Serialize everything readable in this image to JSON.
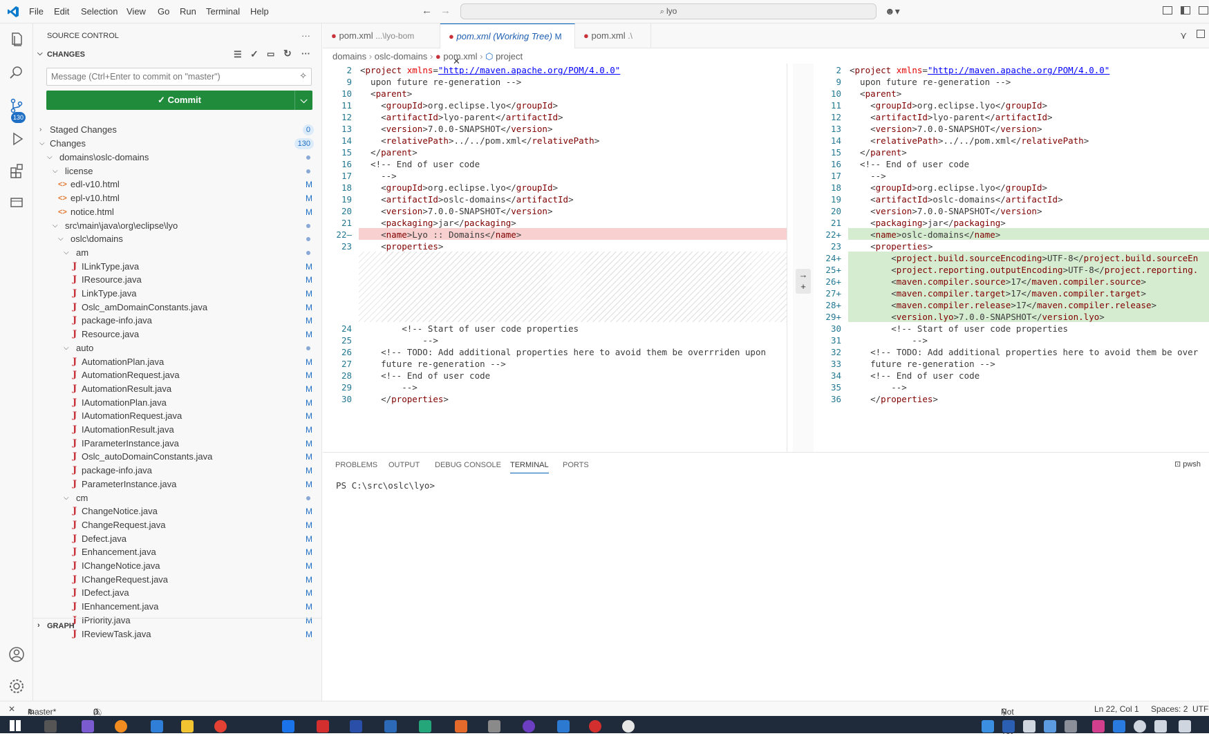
{
  "titlebar": {
    "menus": [
      "File",
      "Edit",
      "Selection",
      "View",
      "Go",
      "Run",
      "Terminal",
      "Help"
    ],
    "search": "lyo"
  },
  "activity": {
    "scm_badge": "130"
  },
  "sidebar": {
    "title": "SOURCE CONTROL",
    "changes_header": "CHANGES",
    "message_placeholder": "Message (Ctrl+Enter to commit on \"master\")",
    "commit_label": "Commit",
    "staged_label": "Staged Changes",
    "staged_count": "0",
    "changes_label": "Changes",
    "changes_count": "130",
    "graph_label": "GRAPH",
    "tree": [
      {
        "label": "domains\\oslc-domains",
        "type": "folder",
        "depth": 1,
        "status": "dot"
      },
      {
        "label": "license",
        "type": "folder",
        "depth": 2,
        "status": "dot"
      },
      {
        "label": "edl-v10.html",
        "type": "html",
        "depth": 3,
        "status": "M"
      },
      {
        "label": "epl-v10.html",
        "type": "html",
        "depth": 3,
        "status": "M"
      },
      {
        "label": "notice.html",
        "type": "html",
        "depth": 3,
        "status": "M"
      },
      {
        "label": "src\\main\\java\\org\\eclipse\\lyo",
        "type": "folder",
        "depth": 2,
        "status": "dot"
      },
      {
        "label": "oslc\\domains",
        "type": "folder",
        "depth": 3,
        "status": "dot"
      },
      {
        "label": "am",
        "type": "folder",
        "depth": 4,
        "status": "dot"
      },
      {
        "label": "ILinkType.java",
        "type": "java",
        "depth": 5,
        "status": "M"
      },
      {
        "label": "IResource.java",
        "type": "java",
        "depth": 5,
        "status": "M"
      },
      {
        "label": "LinkType.java",
        "type": "java",
        "depth": 5,
        "status": "M"
      },
      {
        "label": "Oslc_amDomainConstants.java",
        "type": "java",
        "depth": 5,
        "status": "M"
      },
      {
        "label": "package-info.java",
        "type": "java",
        "depth": 5,
        "status": "M"
      },
      {
        "label": "Resource.java",
        "type": "java",
        "depth": 5,
        "status": "M"
      },
      {
        "label": "auto",
        "type": "folder",
        "depth": 4,
        "status": "dot"
      },
      {
        "label": "AutomationPlan.java",
        "type": "java",
        "depth": 5,
        "status": "M"
      },
      {
        "label": "AutomationRequest.java",
        "type": "java",
        "depth": 5,
        "status": "M"
      },
      {
        "label": "AutomationResult.java",
        "type": "java",
        "depth": 5,
        "status": "M"
      },
      {
        "label": "IAutomationPlan.java",
        "type": "java",
        "depth": 5,
        "status": "M"
      },
      {
        "label": "IAutomationRequest.java",
        "type": "java",
        "depth": 5,
        "status": "M"
      },
      {
        "label": "IAutomationResult.java",
        "type": "java",
        "depth": 5,
        "status": "M"
      },
      {
        "label": "IParameterInstance.java",
        "type": "java",
        "depth": 5,
        "status": "M"
      },
      {
        "label": "Oslc_autoDomainConstants.java",
        "type": "java",
        "depth": 5,
        "status": "M"
      },
      {
        "label": "package-info.java",
        "type": "java",
        "depth": 5,
        "status": "M"
      },
      {
        "label": "ParameterInstance.java",
        "type": "java",
        "depth": 5,
        "status": "M"
      },
      {
        "label": "cm",
        "type": "folder",
        "depth": 4,
        "status": "dot"
      },
      {
        "label": "ChangeNotice.java",
        "type": "java",
        "depth": 5,
        "status": "M"
      },
      {
        "label": "ChangeRequest.java",
        "type": "java",
        "depth": 5,
        "status": "M"
      },
      {
        "label": "Defect.java",
        "type": "java",
        "depth": 5,
        "status": "M"
      },
      {
        "label": "Enhancement.java",
        "type": "java",
        "depth": 5,
        "status": "M"
      },
      {
        "label": "IChangeNotice.java",
        "type": "java",
        "depth": 5,
        "status": "M"
      },
      {
        "label": "IChangeRequest.java",
        "type": "java",
        "depth": 5,
        "status": "M"
      },
      {
        "label": "IDefect.java",
        "type": "java",
        "depth": 5,
        "status": "M"
      },
      {
        "label": "IEnhancement.java",
        "type": "java",
        "depth": 5,
        "status": "M"
      },
      {
        "label": "IPriority.java",
        "type": "java",
        "depth": 5,
        "status": "M"
      },
      {
        "label": "IReviewTask.java",
        "type": "java",
        "depth": 5,
        "status": "M"
      }
    ]
  },
  "editor": {
    "tabs": [
      {
        "name": "pom.xml",
        "desc": "...\\lyo-bom",
        "active": false
      },
      {
        "name": "pom.xml (Working Tree)",
        "desc": "M",
        "active": true
      },
      {
        "name": "pom.xml",
        "desc": ".\\",
        "active": false
      }
    ],
    "breadcrumbs": [
      "domains",
      "oslc-domains",
      "pom.xml",
      "project"
    ],
    "left_lines": [
      {
        "n": "2",
        "t": "<project xmlns=\"http://maven.apache.org/POM/4.0.0\""
      },
      {
        "n": "9",
        "t": "  upon future re-generation -->"
      },
      {
        "n": "10",
        "t": "  <parent>"
      },
      {
        "n": "11",
        "t": "    <groupId>org.eclipse.lyo</groupId>"
      },
      {
        "n": "12",
        "t": "    <artifactId>lyo-parent</artifactId>"
      },
      {
        "n": "13",
        "t": "    <version>7.0.0-SNAPSHOT</version>"
      },
      {
        "n": "14",
        "t": "    <relativePath>../../pom.xml</relativePath>"
      },
      {
        "n": "15",
        "t": "  </parent>"
      },
      {
        "n": "16",
        "t": "  <!-- End of user code"
      },
      {
        "n": "17",
        "t": "    -->"
      },
      {
        "n": "18",
        "t": "    <groupId>org.eclipse.lyo</groupId>"
      },
      {
        "n": "19",
        "t": "    <artifactId>oslc-domains</artifactId>"
      },
      {
        "n": "20",
        "t": "    <version>7.0.0-SNAPSHOT</version>"
      },
      {
        "n": "21",
        "t": "    <packaging>jar</packaging>"
      },
      {
        "n": "22—",
        "t": "    <name>Lyo :: Domains</name>"
      },
      {
        "n": "23",
        "t": "    <properties>"
      },
      {
        "n": "",
        "t": ""
      },
      {
        "n": "",
        "t": ""
      },
      {
        "n": "",
        "t": ""
      },
      {
        "n": "",
        "t": ""
      },
      {
        "n": "",
        "t": ""
      },
      {
        "n": "",
        "t": ""
      },
      {
        "n": "24",
        "t": "        <!-- Start of user code properties"
      },
      {
        "n": "25",
        "t": "            -->"
      },
      {
        "n": "26",
        "t": "    <!-- TODO: Add additional properties here to avoid them be overrriden upon"
      },
      {
        "n": "27",
        "t": "    future re-generation -->"
      },
      {
        "n": "28",
        "t": "    <!-- End of user code"
      },
      {
        "n": "29",
        "t": "        -->"
      },
      {
        "n": "30",
        "t": "    </properties>"
      }
    ],
    "right_lines": [
      {
        "n": "2",
        "t": "<project xmlns=\"http://maven.apache.org/POM/4.0.0\""
      },
      {
        "n": "9",
        "t": "  upon future re-generation -->"
      },
      {
        "n": "10",
        "t": "  <parent>"
      },
      {
        "n": "11",
        "t": "    <groupId>org.eclipse.lyo</groupId>"
      },
      {
        "n": "12",
        "t": "    <artifactId>lyo-parent</artifactId>"
      },
      {
        "n": "13",
        "t": "    <version>7.0.0-SNAPSHOT</version>"
      },
      {
        "n": "14",
        "t": "    <relativePath>../../pom.xml</relativePath>"
      },
      {
        "n": "15",
        "t": "  </parent>"
      },
      {
        "n": "16",
        "t": "  <!-- End of user code"
      },
      {
        "n": "17",
        "t": "    -->"
      },
      {
        "n": "18",
        "t": "    <groupId>org.eclipse.lyo</groupId>"
      },
      {
        "n": "19",
        "t": "    <artifactId>oslc-domains</artifactId>"
      },
      {
        "n": "20",
        "t": "    <version>7.0.0-SNAPSHOT</version>"
      },
      {
        "n": "21",
        "t": "    <packaging>jar</packaging>"
      },
      {
        "n": "22+",
        "t": "    <name>oslc-domains</name>"
      },
      {
        "n": "23",
        "t": "    <properties>"
      },
      {
        "n": "24+",
        "t": "        <project.build.sourceEncoding>UTF-8</project.build.sourceEn"
      },
      {
        "n": "25+",
        "t": "        <project.reporting.outputEncoding>UTF-8</project.reporting."
      },
      {
        "n": "26+",
        "t": "        <maven.compiler.source>17</maven.compiler.source>"
      },
      {
        "n": "27+",
        "t": "        <maven.compiler.target>17</maven.compiler.target>"
      },
      {
        "n": "28+",
        "t": "        <maven.compiler.release>17</maven.compiler.release>"
      },
      {
        "n": "29+",
        "t": "        <version.lyo>7.0.0-SNAPSHOT</version.lyo>"
      },
      {
        "n": "30",
        "t": "        <!-- Start of user code properties"
      },
      {
        "n": "31",
        "t": "            -->"
      },
      {
        "n": "32",
        "t": "    <!-- TODO: Add additional properties here to avoid them be over"
      },
      {
        "n": "33",
        "t": "    future re-generation -->"
      },
      {
        "n": "34",
        "t": "    <!-- End of user code"
      },
      {
        "n": "35",
        "t": "        -->"
      },
      {
        "n": "36",
        "t": "    </properties>"
      }
    ]
  },
  "panel": {
    "tabs": [
      "PROBLEMS",
      "OUTPUT",
      "DEBUG CONSOLE",
      "TERMINAL",
      "PORTS"
    ],
    "active_tab": "TERMINAL",
    "shell": "pwsh",
    "prompt": "PS C:\\src\\oslc\\lyo>"
  },
  "statusbar": {
    "branch": "master*",
    "problems": "0",
    "warnings": "0",
    "blame": "Not Committed Yet",
    "cursor": "Ln 22, Col 1",
    "spaces": "Spaces: 2",
    "encoding": "UTF-"
  }
}
